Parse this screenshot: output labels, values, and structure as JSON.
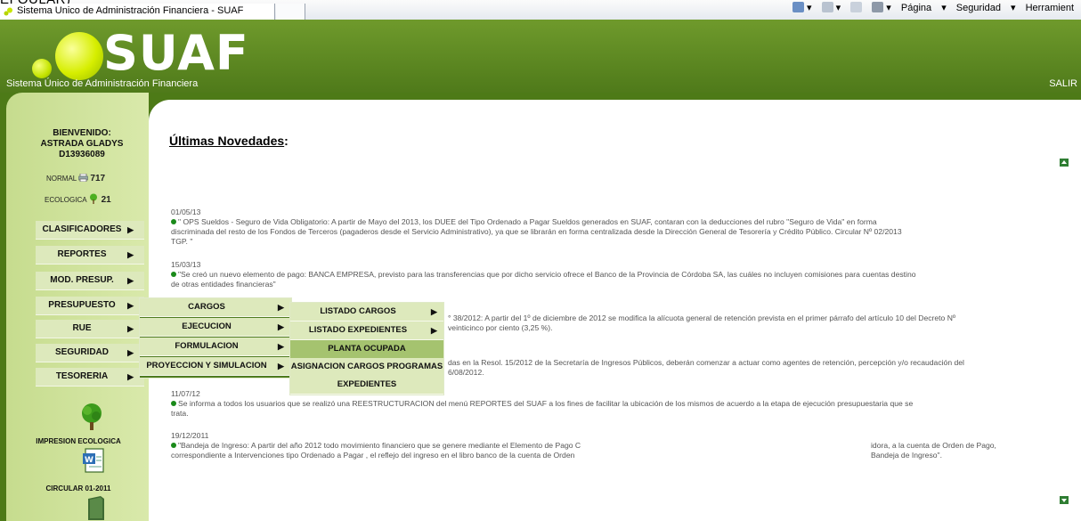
{
  "browser": {
    "fragment_text": "EI QULAR)",
    "tab_title": "Sistema Unico de Administración Financiera - SUAF",
    "commands": [
      "Página",
      "Seguridad",
      "Herramient"
    ]
  },
  "header": {
    "logo_text": "SUAF",
    "subtitle": "Sistema Único de Administración Financiera",
    "logout": "SALIR"
  },
  "sidebar": {
    "welcome": [
      "BIENVENIDO:",
      "ASTRADA GLADYS",
      "D13936089"
    ],
    "normal_label": "NORMAL",
    "normal_count": "717",
    "eco_label": "ECOLOGICA",
    "eco_count": "21",
    "menu": [
      {
        "label": "CLASIFICADORES"
      },
      {
        "label": "REPORTES"
      },
      {
        "label": "MOD. PRESUP."
      },
      {
        "label": "PRESUPUESTO"
      },
      {
        "label": "RUE"
      },
      {
        "label": "SEGURIDAD"
      },
      {
        "label": "TESORERIA"
      }
    ],
    "eco_print_label": "IMPRESION ECOLOGICA",
    "circular_label": "CIRCULAR 01-2011"
  },
  "submenu1": [
    {
      "label": "CARGOS"
    },
    {
      "label": "EJECUCION"
    },
    {
      "label": "FORMULACION"
    },
    {
      "label": "PROYECCION Y SIMULACION"
    }
  ],
  "submenu2": [
    {
      "label": "LISTADO CARGOS"
    },
    {
      "label": "LISTADO EXPEDIENTES"
    },
    {
      "label": "PLANTA OCUPADA"
    },
    {
      "label": "ASIGNACION CARGOS PROGRAMAS"
    },
    {
      "label": "EXPEDIENTES"
    }
  ],
  "content": {
    "title": "Últimas Novedades",
    "title_colon": ":",
    "news": [
      {
        "date": "01/05/13",
        "lines": [
          "\" OPS Sueldos - Seguro de Vida Obligatorio: A partir de Mayo del 2013, los DUEE del Tipo Ordenado a Pagar Sueldos generados en SUAF, contaran con la deducciones del rubro \"Seguro de Vida\" en forma",
          "discriminada del resto de los Fondos de Terceros (pagaderos desde el Servicio Administrativo), ya que se librarán en forma centralizada desde la Dirección General de Tesorería y Crédito Público. Circular Nº 02/2013",
          "TGP. \""
        ]
      },
      {
        "date": "15/03/13",
        "lines": [
          "\"Se creó un nuevo elemento de pago: BANCA EMPRESA, previsto para las transferencias que por dicho servicio ofrece el Banco de la Provincia de Córdoba SA, las cuáles no incluyen comisiones para cuentas destino",
          "de otras entidades financieras\""
        ]
      },
      {
        "date": "",
        "lines": [
          "° 38/2012: A partir del 1º de diciembre de 2012 se modifica la alícuota general de retención prevista en el primer párrafo del artículo 10 del Decreto Nº",
          "veinticinco por ciento (3,25 %)."
        ]
      },
      {
        "date": "",
        "lines": [
          "das en la Resol. 15/2012 de la Secretaría de Ingresos Públicos, deberán comenzar a actuar como agentes de retención, percepción y/o recaudación del",
          "6/08/2012."
        ]
      },
      {
        "date": "11/07/12",
        "lines": [
          "Se informa a todos los usuarios que se realizó una REESTRUCTURACION del menú REPORTES del SUAF a los fines de facilitar la ubicación de los mismos de acuerdo a la etapa de ejecución presupuestaria que se",
          "trata."
        ]
      },
      {
        "date": "19/12/2011",
        "lines": [
          "\"Bandeja de Ingreso: A partir del año 2012 todo movimiento financiero que se genere mediante el Elemento de Pago C",
          "correspondiente a Intervenciones tipo Ordenado a Pagar , el reflejo del ingreso en el libro banco de la cuenta de Orden"
        ],
        "lines_right": [
          "idora, a la cuenta de Orden de Pago,",
          "Bandeja de Ingreso\"."
        ]
      }
    ]
  }
}
